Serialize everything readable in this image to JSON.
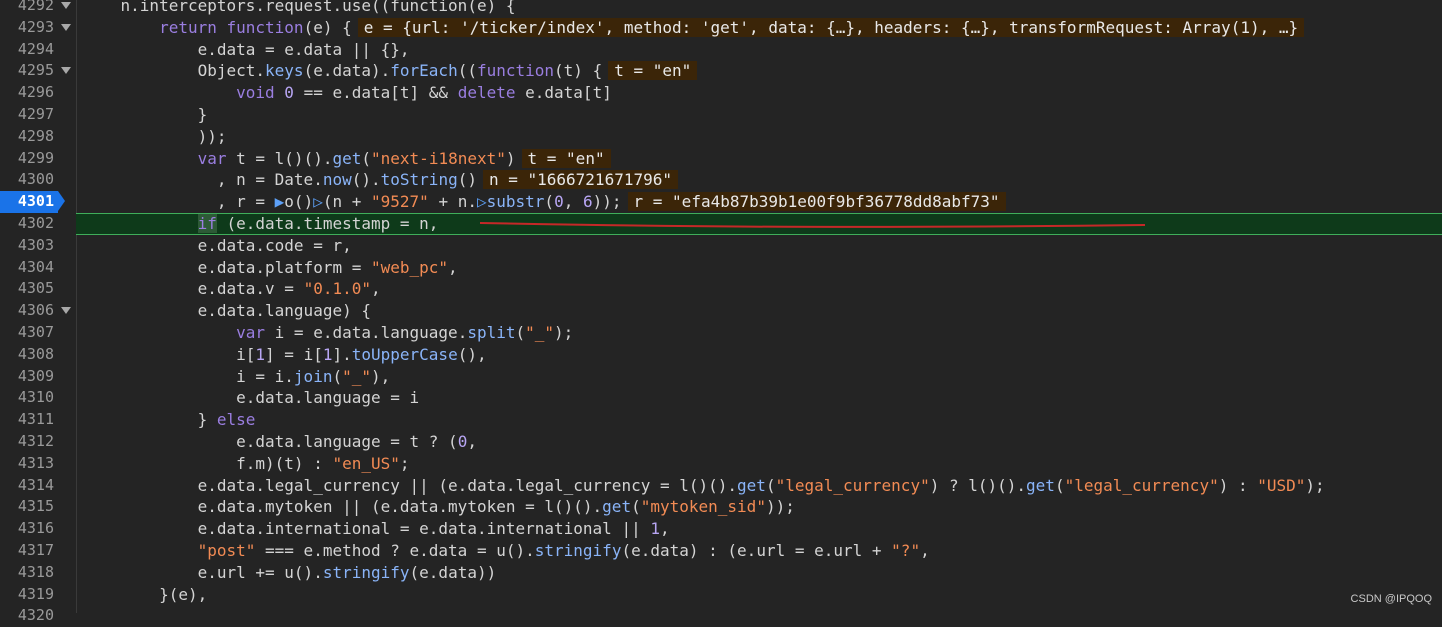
{
  "lines": [
    {
      "num": "4292",
      "fold": true,
      "indent": "    ",
      "parts": [
        [
          "n.interceptors.request.use((function(e) {",
          ""
        ]
      ]
    },
    {
      "num": "4293",
      "fold": true,
      "indent": "        ",
      "parts": [
        [
          "return",
          "kw"
        ],
        [
          " ",
          ""
        ],
        [
          "function",
          "kw"
        ],
        [
          "(e) {",
          ""
        ],
        [
          "e = {url: '/ticker/index', method: 'get', data: {…}, headers: {…}, transformRequest: Array(1), …}",
          "tip"
        ]
      ]
    },
    {
      "num": "4294",
      "fold": false,
      "indent": "            ",
      "parts": [
        [
          "e.data = e.data || {},",
          ""
        ]
      ]
    },
    {
      "num": "4295",
      "fold": true,
      "indent": "            ",
      "parts": [
        [
          "Object.",
          ""
        ],
        [
          "keys",
          "fn"
        ],
        [
          "(e.data).",
          ""
        ],
        [
          "forEach",
          "fn"
        ],
        [
          "((",
          ""
        ],
        [
          "function",
          "kw"
        ],
        [
          "(t) {",
          ""
        ],
        [
          "t = \"en\"",
          "tip"
        ]
      ]
    },
    {
      "num": "4296",
      "fold": false,
      "indent": "                ",
      "parts": [
        [
          "void",
          "kw"
        ],
        [
          " ",
          ""
        ],
        [
          "0",
          "num"
        ],
        [
          " == e.data[t] && ",
          ""
        ],
        [
          "delete",
          "kw"
        ],
        [
          " e.data[t]",
          ""
        ]
      ]
    },
    {
      "num": "4297",
      "fold": false,
      "indent": "            ",
      "parts": [
        [
          "}",
          ""
        ]
      ]
    },
    {
      "num": "4298",
      "fold": false,
      "indent": "            ",
      "parts": [
        [
          "));",
          ""
        ]
      ]
    },
    {
      "num": "4299",
      "fold": false,
      "indent": "            ",
      "parts": [
        [
          "var",
          "kw"
        ],
        [
          " t = l()().",
          ""
        ],
        [
          "get",
          "fn"
        ],
        [
          "(",
          ""
        ],
        [
          "\"next-i18next\"",
          "str"
        ],
        [
          ")",
          ""
        ],
        [
          "t = \"en\"",
          "tip"
        ]
      ]
    },
    {
      "num": "4300",
      "fold": false,
      "indent": "              ",
      "parts": [
        [
          ", n = Date.",
          ""
        ],
        [
          "now",
          "fn"
        ],
        [
          "().",
          ""
        ],
        [
          "toString",
          "fn"
        ],
        [
          "()",
          ""
        ],
        [
          "n = \"1666721671796\"",
          "tip"
        ]
      ]
    },
    {
      "num": "4301",
      "fold": false,
      "indent": "              ",
      "breakpoint": true,
      "parts": [
        [
          ", r = ",
          ""
        ],
        [
          "▶",
          "marker"
        ],
        [
          "o()",
          ""
        ],
        [
          "▷",
          "marker"
        ],
        [
          "(n + ",
          ""
        ],
        [
          "\"9527\"",
          "str"
        ],
        [
          " + n.",
          ""
        ],
        [
          "▷",
          "marker"
        ],
        [
          "substr",
          "fn"
        ],
        [
          "(",
          ""
        ],
        [
          "0",
          "num"
        ],
        [
          ", ",
          ""
        ],
        [
          "6",
          "num"
        ],
        [
          "));",
          ""
        ],
        [
          "r = \"efa4b87b39b1e00f9bf36778dd8abf73\"",
          "tip"
        ]
      ]
    },
    {
      "num": "4302",
      "fold": false,
      "indent": "            ",
      "exec": true,
      "parts": [
        [
          "if",
          "kw tok-hl"
        ],
        [
          " (e.data.timestamp = n,",
          ""
        ]
      ]
    },
    {
      "num": "4303",
      "fold": false,
      "indent": "            ",
      "parts": [
        [
          "e.data.code = r,",
          ""
        ]
      ]
    },
    {
      "num": "4304",
      "fold": false,
      "indent": "            ",
      "parts": [
        [
          "e.data.platform = ",
          ""
        ],
        [
          "\"web_pc\"",
          "str"
        ],
        [
          ",",
          ""
        ]
      ]
    },
    {
      "num": "4305",
      "fold": false,
      "indent": "            ",
      "parts": [
        [
          "e.data.v = ",
          ""
        ],
        [
          "\"0.1.0\"",
          "str"
        ],
        [
          ",",
          ""
        ]
      ]
    },
    {
      "num": "4306",
      "fold": true,
      "indent": "            ",
      "parts": [
        [
          "e.data.language) {",
          ""
        ]
      ]
    },
    {
      "num": "4307",
      "fold": false,
      "indent": "                ",
      "parts": [
        [
          "var",
          "kw"
        ],
        [
          " i = e.data.language.",
          ""
        ],
        [
          "split",
          "fn"
        ],
        [
          "(",
          ""
        ],
        [
          "\"_\"",
          "str"
        ],
        [
          ");",
          ""
        ]
      ]
    },
    {
      "num": "4308",
      "fold": false,
      "indent": "                ",
      "parts": [
        [
          "i[",
          ""
        ],
        [
          "1",
          "num"
        ],
        [
          "] = i[",
          ""
        ],
        [
          "1",
          "num"
        ],
        [
          "].",
          ""
        ],
        [
          "toUpperCase",
          "fn"
        ],
        [
          "(),",
          ""
        ]
      ]
    },
    {
      "num": "4309",
      "fold": false,
      "indent": "                ",
      "parts": [
        [
          "i = i.",
          ""
        ],
        [
          "join",
          "fn"
        ],
        [
          "(",
          ""
        ],
        [
          "\"_\"",
          "str"
        ],
        [
          "),",
          ""
        ]
      ]
    },
    {
      "num": "4310",
      "fold": false,
      "indent": "                ",
      "parts": [
        [
          "e.data.language = i",
          ""
        ]
      ]
    },
    {
      "num": "4311",
      "fold": false,
      "indent": "            ",
      "parts": [
        [
          "} ",
          ""
        ],
        [
          "else",
          "kw"
        ]
      ]
    },
    {
      "num": "4312",
      "fold": false,
      "indent": "                ",
      "parts": [
        [
          "e.data.language = t ? (",
          ""
        ],
        [
          "0",
          "num"
        ],
        [
          ",",
          ""
        ]
      ]
    },
    {
      "num": "4313",
      "fold": false,
      "indent": "                ",
      "parts": [
        [
          "f.m)(t) : ",
          ""
        ],
        [
          "\"en_US\"",
          "str"
        ],
        [
          ";",
          ""
        ]
      ]
    },
    {
      "num": "4314",
      "fold": false,
      "indent": "            ",
      "parts": [
        [
          "e.data.legal_currency || (e.data.legal_currency = l()().",
          ""
        ],
        [
          "get",
          "fn"
        ],
        [
          "(",
          ""
        ],
        [
          "\"legal_currency\"",
          "str"
        ],
        [
          ") ? l()().",
          ""
        ],
        [
          "get",
          "fn"
        ],
        [
          "(",
          ""
        ],
        [
          "\"legal_currency\"",
          "str"
        ],
        [
          ") : ",
          ""
        ],
        [
          "\"USD\"",
          "str"
        ],
        [
          ");",
          ""
        ]
      ]
    },
    {
      "num": "4315",
      "fold": false,
      "indent": "            ",
      "parts": [
        [
          "e.data.mytoken || (e.data.mytoken = l()().",
          ""
        ],
        [
          "get",
          "fn"
        ],
        [
          "(",
          ""
        ],
        [
          "\"mytoken_sid\"",
          "str"
        ],
        [
          "));",
          ""
        ]
      ]
    },
    {
      "num": "4316",
      "fold": false,
      "indent": "            ",
      "parts": [
        [
          "e.data.international = e.data.international || ",
          ""
        ],
        [
          "1",
          "num"
        ],
        [
          ",",
          ""
        ]
      ]
    },
    {
      "num": "4317",
      "fold": false,
      "indent": "            ",
      "parts": [
        [
          "\"post\"",
          "str"
        ],
        [
          " === e.method ? e.data = u().",
          ""
        ],
        [
          "stringify",
          "fn"
        ],
        [
          "(e.data) : (e.url = e.url + ",
          ""
        ],
        [
          "\"?\"",
          "str"
        ],
        [
          ",",
          ""
        ]
      ]
    },
    {
      "num": "4318",
      "fold": false,
      "indent": "            ",
      "parts": [
        [
          "e.url += u().",
          ""
        ],
        [
          "stringify",
          "fn"
        ],
        [
          "(e.data))",
          ""
        ]
      ]
    },
    {
      "num": "4319",
      "fold": false,
      "indent": "        ",
      "parts": [
        [
          "}(e),",
          ""
        ]
      ]
    },
    {
      "num": "4320",
      "fold": false,
      "indent": "",
      "parts": [
        [
          "",
          ""
        ]
      ]
    }
  ],
  "watermark": "CSDN @IPQOQ",
  "colors": {
    "keyword": "#9a7ee0",
    "function": "#8ab4f8",
    "string": "#f28b54",
    "breakpoint": "#1a73e8",
    "exec_line": "#0e3a1a",
    "tooltip": "#3b2508",
    "underline": "#c62828"
  }
}
